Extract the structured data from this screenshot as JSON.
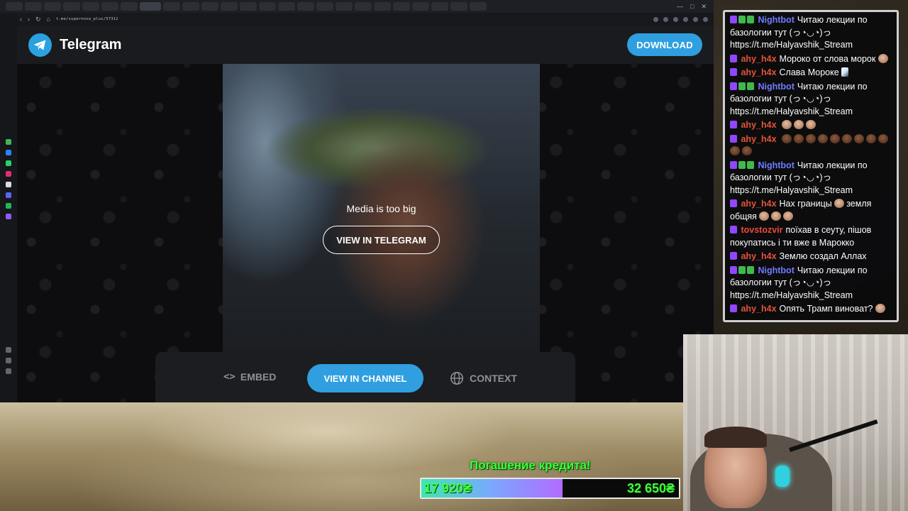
{
  "browser": {
    "url": "t.me/supernova_plus/57312"
  },
  "telegram": {
    "brand": "Telegram",
    "download_label": "DOWNLOAD",
    "media_notice": "Media is too big",
    "view_in_telegram_label": "VIEW IN TELEGRAM",
    "embed_label": "EMBED",
    "view_in_channel_label": "VIEW IN CHANNEL",
    "context_label": "CONTEXT",
    "accent_color": "#2f9fe0"
  },
  "chat": {
    "messages": [
      {
        "user": "Nightbot",
        "kind": "bot",
        "text": "Читаю лекции по базологии тут (っ◔◡◔)っ https://t.me/Halyavshik_Stream"
      },
      {
        "user": "ahy_h4x",
        "kind": "ahy",
        "text": "Мороко от слова морок"
      },
      {
        "user": "ahy_h4x",
        "kind": "ahy",
        "text": "Слава Мороке"
      },
      {
        "user": "Nightbot",
        "kind": "bot",
        "text": "Читаю лекции по базологии тут (っ◔◡◔)っ https://t.me/Halyavshik_Stream"
      },
      {
        "user": "ahy_h4x",
        "kind": "ahy",
        "text": ""
      },
      {
        "user": "ahy_h4x",
        "kind": "ahy",
        "text": ""
      },
      {
        "user": "Nightbot",
        "kind": "bot",
        "text": "Читаю лекции по базологии тут (っ◔◡◔)っ https://t.me/Halyavshik_Stream"
      },
      {
        "user": "ahy_h4x",
        "kind": "ahy",
        "text": "Нах границы",
        "text2": "земля общяя"
      },
      {
        "user": "tovstozvir",
        "kind": "tov",
        "text": "поїхав в сеуту, пішов покупатись і ти вже в Марокко"
      },
      {
        "user": "ahy_h4x",
        "kind": "ahy",
        "text": "Землю создал Аллах"
      },
      {
        "user": "Nightbot",
        "kind": "bot",
        "text": "Читаю лекции по базологии тут (っ◔◡◔)っ https://t.me/Halyavshik_Stream"
      },
      {
        "user": "ahy_h4x",
        "kind": "ahy",
        "text": "Опять Трамп виноват?"
      }
    ]
  },
  "credit": {
    "title": "Погашение кредита!",
    "current": "17 920₴",
    "total": "32 650₴",
    "progress_fraction": 0.549
  }
}
